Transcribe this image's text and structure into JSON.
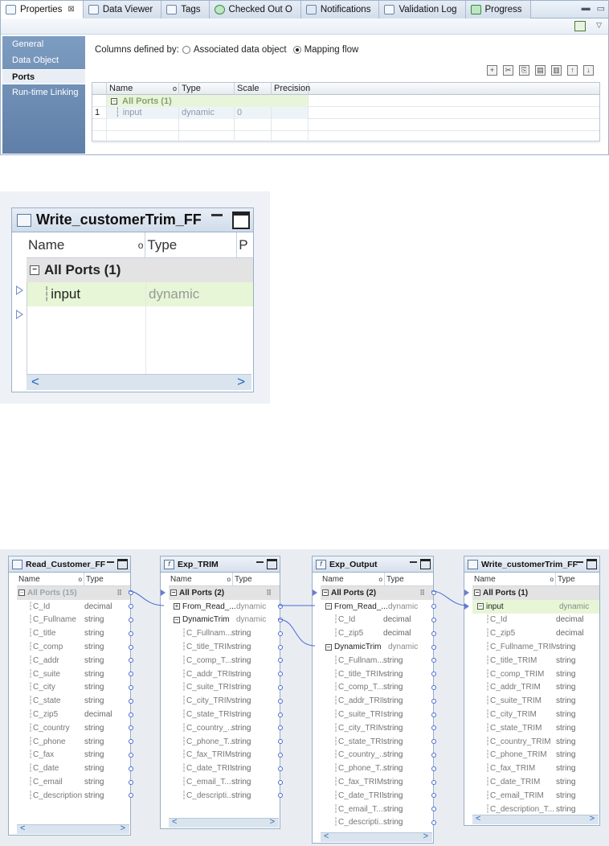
{
  "properties_view": {
    "tabs": [
      {
        "label": "Properties",
        "icon": "properties-icon",
        "active": true
      },
      {
        "label": "Data Viewer",
        "icon": "data-viewer-icon"
      },
      {
        "label": "Tags",
        "icon": "tag-icon"
      },
      {
        "label": "Checked Out O",
        "icon": "checked-out-icon"
      },
      {
        "label": "Notifications",
        "icon": "notifications-icon"
      },
      {
        "label": "Validation Log",
        "icon": "validation-log-icon"
      },
      {
        "label": "Progress",
        "icon": "progress-icon"
      }
    ],
    "close_glyph": "⊠",
    "sidebar": [
      "General",
      "Data Object",
      "Ports",
      "Run-time Linking"
    ],
    "columns_defined_label": "Columns defined by:",
    "option_associated": "Associated data object",
    "option_mapping": "Mapping flow",
    "table_headers": [
      "Name",
      "Type",
      "Scale",
      "Precision"
    ],
    "group_row": "All Ports (1)",
    "row_num": "1",
    "row_name": "input",
    "row_type": "dynamic",
    "row_scale": "0"
  },
  "mid_panel": {
    "title": "Write_customerTrim_FF",
    "col_name": "Name",
    "col_type": "Type",
    "col_p": "P",
    "group": "All Ports (1)",
    "port_name": "input",
    "port_type": "dynamic"
  },
  "mapping": {
    "objects": [
      {
        "title": "Read_Customer_FF",
        "col_name": "Name",
        "col_type": "Type",
        "group": "All Ports (15)",
        "ports": [
          [
            "C_Id",
            "decimal"
          ],
          [
            "C_Fullname",
            "string"
          ],
          [
            "C_title",
            "string"
          ],
          [
            "C_comp",
            "string"
          ],
          [
            "C_addr",
            "string"
          ],
          [
            "C_suite",
            "string"
          ],
          [
            "C_city",
            "string"
          ],
          [
            "C_state",
            "string"
          ],
          [
            "C_zip5",
            "decimal"
          ],
          [
            "C_country",
            "string"
          ],
          [
            "C_phone",
            "string"
          ],
          [
            "C_fax",
            "string"
          ],
          [
            "C_date",
            "string"
          ],
          [
            "C_email",
            "string"
          ],
          [
            "C_description",
            "string"
          ]
        ]
      },
      {
        "title": "Exp_TRIM",
        "col_name": "Name",
        "col_type": "Type",
        "group": "All Ports (2)",
        "sub1": [
          "From_Read_...",
          "dynamic"
        ],
        "sub2": [
          "DynamicTrim",
          "dynamic"
        ],
        "ports": [
          [
            "C_Fullnam...",
            "string"
          ],
          [
            "C_title_TRIM",
            "string"
          ],
          [
            "C_comp_T...",
            "string"
          ],
          [
            "C_addr_TRIM",
            "string"
          ],
          [
            "C_suite_TRI...",
            "string"
          ],
          [
            "C_city_TRIM",
            "string"
          ],
          [
            "C_state_TRI...",
            "string"
          ],
          [
            "C_country_...",
            "string"
          ],
          [
            "C_phone_T...",
            "string"
          ],
          [
            "C_fax_TRIM",
            "string"
          ],
          [
            "C_date_TRIM",
            "string"
          ],
          [
            "C_email_T...",
            "string"
          ],
          [
            "C_descripti...",
            "string"
          ]
        ]
      },
      {
        "title": "Exp_Output",
        "col_name": "Name",
        "col_type": "Type",
        "group": "All Ports (2)",
        "sub1": [
          "From_Read_...",
          "dynamic"
        ],
        "sub1_ports": [
          [
            "C_Id",
            "decimal"
          ],
          [
            "C_zip5",
            "decimal"
          ]
        ],
        "sub2": [
          "DynamicTrim",
          "dynamic"
        ],
        "ports": [
          [
            "C_Fullnam...",
            "string"
          ],
          [
            "C_title_TRIM",
            "string"
          ],
          [
            "C_comp_T...",
            "string"
          ],
          [
            "C_addr_TRIM",
            "string"
          ],
          [
            "C_suite_TRI...",
            "string"
          ],
          [
            "C_city_TRIM",
            "string"
          ],
          [
            "C_state_TRI...",
            "string"
          ],
          [
            "C_country_...",
            "string"
          ],
          [
            "C_phone_T...",
            "string"
          ],
          [
            "C_fax_TRIM",
            "string"
          ],
          [
            "C_date_TRIM",
            "string"
          ],
          [
            "C_email_T...",
            "string"
          ],
          [
            "C_descripti...",
            "string"
          ]
        ]
      },
      {
        "title": "Write_customerTrim_FF",
        "col_name": "Name",
        "col_type": "Type",
        "group": "All Ports (1)",
        "sub1": [
          "input",
          "dynamic"
        ],
        "ports": [
          [
            "C_Id",
            "decimal"
          ],
          [
            "C_zip5",
            "decimal"
          ],
          [
            "C_Fullname_TRIM",
            "string"
          ],
          [
            "C_title_TRIM",
            "string"
          ],
          [
            "C_comp_TRIM",
            "string"
          ],
          [
            "C_addr_TRIM",
            "string"
          ],
          [
            "C_suite_TRIM",
            "string"
          ],
          [
            "C_city_TRIM",
            "string"
          ],
          [
            "C_state_TRIM",
            "string"
          ],
          [
            "C_country_TRIM",
            "string"
          ],
          [
            "C_phone_TRIM",
            "string"
          ],
          [
            "C_fax_TRIM",
            "string"
          ],
          [
            "C_date_TRIM",
            "string"
          ],
          [
            "C_email_TRIM",
            "string"
          ],
          [
            "C_description_T...",
            "string"
          ]
        ]
      }
    ]
  }
}
